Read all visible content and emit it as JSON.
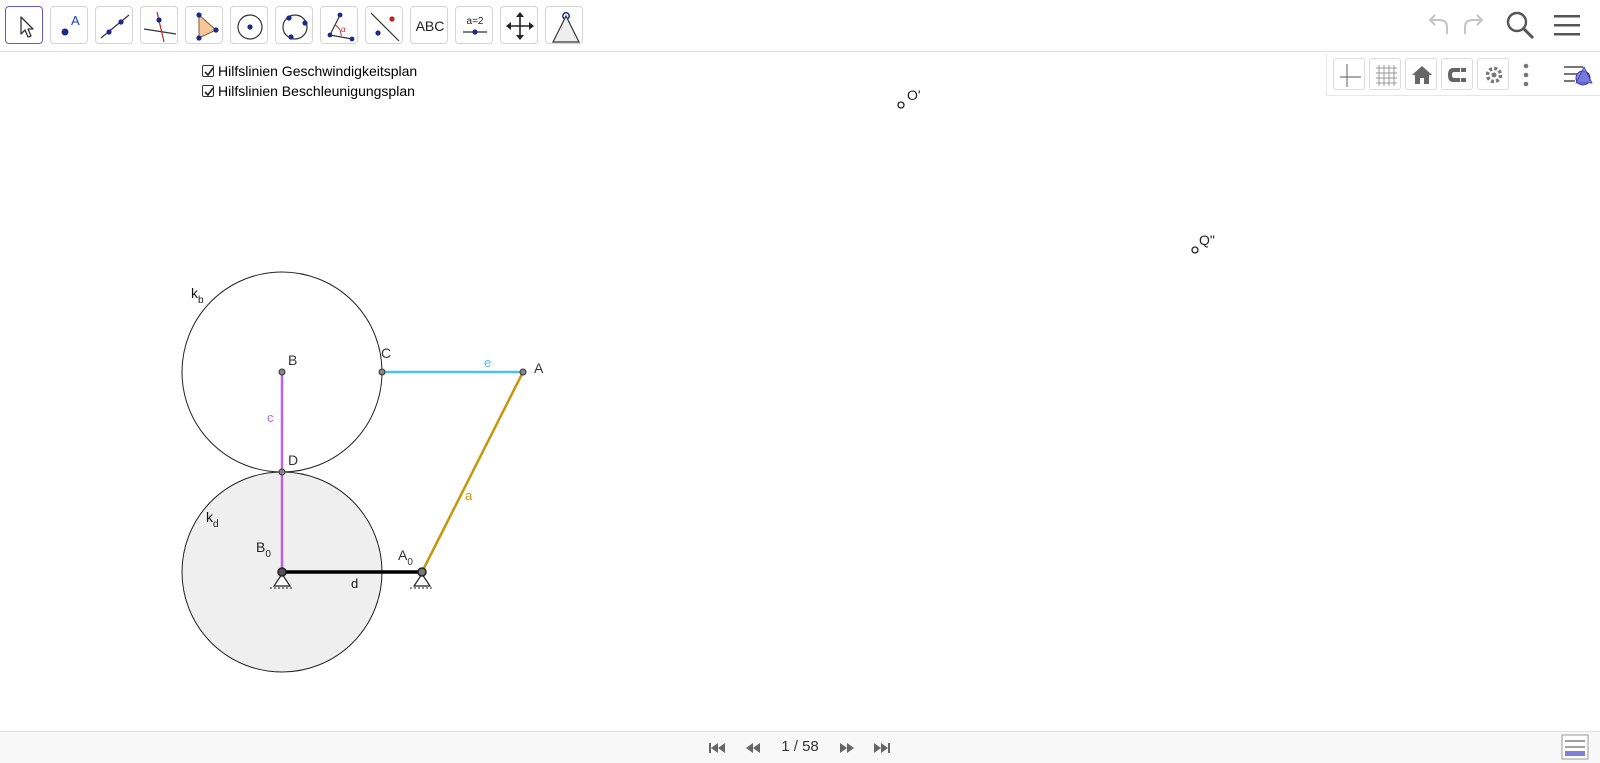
{
  "toolbar": {
    "tools": [
      {
        "name": "move-tool"
      },
      {
        "name": "point-tool",
        "label": "A"
      },
      {
        "name": "line-tool"
      },
      {
        "name": "perpendicular-line-tool"
      },
      {
        "name": "polygon-tool"
      },
      {
        "name": "circle-center-point-tool"
      },
      {
        "name": "circle-three-points-tool"
      },
      {
        "name": "angle-tool",
        "label": "α"
      },
      {
        "name": "reflect-tool"
      },
      {
        "name": "text-tool",
        "label": "ABC"
      },
      {
        "name": "slider-tool",
        "label": "a=2"
      },
      {
        "name": "move-graphics-view-tool"
      },
      {
        "name": "custom-tool"
      }
    ],
    "right_icons": [
      "undo-icon",
      "redo-icon",
      "search-icon",
      "menu-icon"
    ]
  },
  "style_bar": {
    "icons": [
      "axes-icon",
      "grid-icon",
      "home-icon",
      "point-capturing-icon",
      "settings-icon",
      "more-icon",
      "style-bar-toggle-icon"
    ]
  },
  "checkboxes": [
    {
      "label": "Hilfslinien Geschwindigkeitsplan",
      "checked": true
    },
    {
      "label": "Hilfslinien Beschleunigungsplan",
      "checked": true
    }
  ],
  "construction": {
    "points": {
      "A": "A",
      "B": "B",
      "C": "C",
      "D": "D",
      "B0_main": "B",
      "B0_sub": "0",
      "A0_main": "A",
      "A0_sub": "0",
      "O_prime": "O'",
      "Q_double_prime": "Q\""
    },
    "segments": {
      "a": "a",
      "c": "c",
      "d": "d",
      "e": "e"
    },
    "circles": {
      "kb_main": "k",
      "kb_sub": "b",
      "kd_main": "k",
      "kd_sub": "d"
    },
    "colors": {
      "a": "#c8960a",
      "c": "#c060e8",
      "e": "#4fbdf0",
      "d": "#000000",
      "disk_fill": "#efefef"
    }
  },
  "navigation": {
    "page_indicator": "1 / 58",
    "icons": [
      "first-page-icon",
      "previous-page-icon",
      "next-page-icon",
      "last-page-icon"
    ]
  },
  "algebra_toggle_icon": "algebra-view-icon"
}
